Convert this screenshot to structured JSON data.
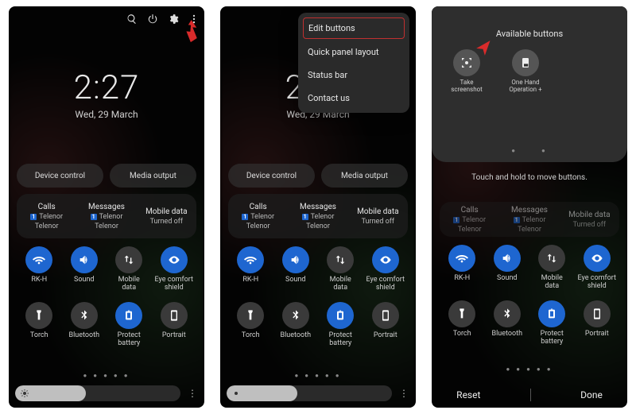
{
  "clock": {
    "time": "2:27",
    "date": "Wed, 29 March"
  },
  "pills": {
    "device_control": "Device control",
    "media_output": "Media output"
  },
  "card": {
    "calls": {
      "header": "Calls",
      "sim_no": "1",
      "sim_label": "Telenor",
      "line2": "Telenor"
    },
    "messages": {
      "header": "Messages",
      "sim_no": "1",
      "sim_label": "Telenor",
      "line2": "Telenor"
    },
    "data": {
      "header": "Mobile data",
      "line2": "Turned off"
    }
  },
  "tiles": {
    "row1": [
      {
        "key": "wifi",
        "label": "RK-H",
        "on": true
      },
      {
        "key": "sound",
        "label": "Sound",
        "on": true
      },
      {
        "key": "mobile_data",
        "label": "Mobile\ndata",
        "on": false
      },
      {
        "key": "eye",
        "label": "Eye comfort\nshield",
        "on": true
      }
    ],
    "row2": [
      {
        "key": "torch",
        "label": "Torch",
        "on": false
      },
      {
        "key": "bluetooth",
        "label": "Bluetooth",
        "on": false
      },
      {
        "key": "protect",
        "label": "Protect battery",
        "on": true
      },
      {
        "key": "portrait",
        "label": "Portrait",
        "on": false
      }
    ]
  },
  "menu": {
    "edit_buttons": "Edit buttons",
    "quick_panel_layout": "Quick panel layout",
    "status_bar": "Status bar",
    "contact_us": "Contact us"
  },
  "panel3": {
    "available_title": "Available buttons",
    "take_screenshot": "Take screenshot",
    "one_hand": "One Hand\nOperation +",
    "hint": "Touch and hold to move buttons.",
    "reset": "Reset",
    "done": "Done"
  },
  "colors": {
    "accent": "#1e66d0",
    "highlight": "#c03030",
    "arrow": "#d92b2b"
  }
}
